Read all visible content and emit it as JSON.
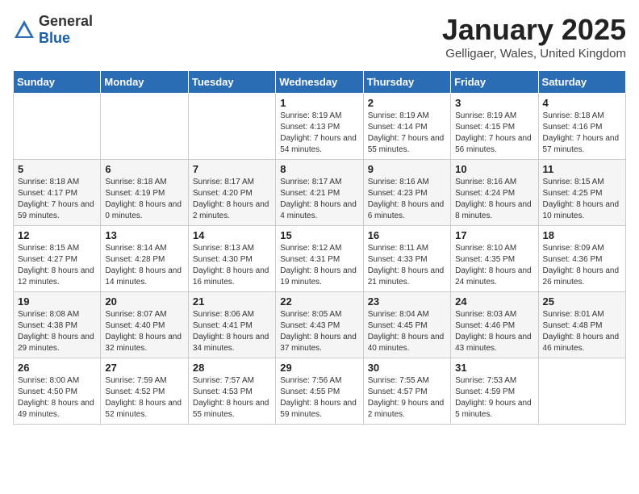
{
  "logo": {
    "text_general": "General",
    "text_blue": "Blue"
  },
  "header": {
    "month": "January 2025",
    "location": "Gelligaer, Wales, United Kingdom"
  },
  "weekdays": [
    "Sunday",
    "Monday",
    "Tuesday",
    "Wednesday",
    "Thursday",
    "Friday",
    "Saturday"
  ],
  "weeks": [
    [
      {
        "day": "",
        "sunrise": "",
        "sunset": "",
        "daylight": ""
      },
      {
        "day": "",
        "sunrise": "",
        "sunset": "",
        "daylight": ""
      },
      {
        "day": "",
        "sunrise": "",
        "sunset": "",
        "daylight": ""
      },
      {
        "day": "1",
        "sunrise": "Sunrise: 8:19 AM",
        "sunset": "Sunset: 4:13 PM",
        "daylight": "Daylight: 7 hours and 54 minutes."
      },
      {
        "day": "2",
        "sunrise": "Sunrise: 8:19 AM",
        "sunset": "Sunset: 4:14 PM",
        "daylight": "Daylight: 7 hours and 55 minutes."
      },
      {
        "day": "3",
        "sunrise": "Sunrise: 8:19 AM",
        "sunset": "Sunset: 4:15 PM",
        "daylight": "Daylight: 7 hours and 56 minutes."
      },
      {
        "day": "4",
        "sunrise": "Sunrise: 8:18 AM",
        "sunset": "Sunset: 4:16 PM",
        "daylight": "Daylight: 7 hours and 57 minutes."
      }
    ],
    [
      {
        "day": "5",
        "sunrise": "Sunrise: 8:18 AM",
        "sunset": "Sunset: 4:17 PM",
        "daylight": "Daylight: 7 hours and 59 minutes."
      },
      {
        "day": "6",
        "sunrise": "Sunrise: 8:18 AM",
        "sunset": "Sunset: 4:19 PM",
        "daylight": "Daylight: 8 hours and 0 minutes."
      },
      {
        "day": "7",
        "sunrise": "Sunrise: 8:17 AM",
        "sunset": "Sunset: 4:20 PM",
        "daylight": "Daylight: 8 hours and 2 minutes."
      },
      {
        "day": "8",
        "sunrise": "Sunrise: 8:17 AM",
        "sunset": "Sunset: 4:21 PM",
        "daylight": "Daylight: 8 hours and 4 minutes."
      },
      {
        "day": "9",
        "sunrise": "Sunrise: 8:16 AM",
        "sunset": "Sunset: 4:23 PM",
        "daylight": "Daylight: 8 hours and 6 minutes."
      },
      {
        "day": "10",
        "sunrise": "Sunrise: 8:16 AM",
        "sunset": "Sunset: 4:24 PM",
        "daylight": "Daylight: 8 hours and 8 minutes."
      },
      {
        "day": "11",
        "sunrise": "Sunrise: 8:15 AM",
        "sunset": "Sunset: 4:25 PM",
        "daylight": "Daylight: 8 hours and 10 minutes."
      }
    ],
    [
      {
        "day": "12",
        "sunrise": "Sunrise: 8:15 AM",
        "sunset": "Sunset: 4:27 PM",
        "daylight": "Daylight: 8 hours and 12 minutes."
      },
      {
        "day": "13",
        "sunrise": "Sunrise: 8:14 AM",
        "sunset": "Sunset: 4:28 PM",
        "daylight": "Daylight: 8 hours and 14 minutes."
      },
      {
        "day": "14",
        "sunrise": "Sunrise: 8:13 AM",
        "sunset": "Sunset: 4:30 PM",
        "daylight": "Daylight: 8 hours and 16 minutes."
      },
      {
        "day": "15",
        "sunrise": "Sunrise: 8:12 AM",
        "sunset": "Sunset: 4:31 PM",
        "daylight": "Daylight: 8 hours and 19 minutes."
      },
      {
        "day": "16",
        "sunrise": "Sunrise: 8:11 AM",
        "sunset": "Sunset: 4:33 PM",
        "daylight": "Daylight: 8 hours and 21 minutes."
      },
      {
        "day": "17",
        "sunrise": "Sunrise: 8:10 AM",
        "sunset": "Sunset: 4:35 PM",
        "daylight": "Daylight: 8 hours and 24 minutes."
      },
      {
        "day": "18",
        "sunrise": "Sunrise: 8:09 AM",
        "sunset": "Sunset: 4:36 PM",
        "daylight": "Daylight: 8 hours and 26 minutes."
      }
    ],
    [
      {
        "day": "19",
        "sunrise": "Sunrise: 8:08 AM",
        "sunset": "Sunset: 4:38 PM",
        "daylight": "Daylight: 8 hours and 29 minutes."
      },
      {
        "day": "20",
        "sunrise": "Sunrise: 8:07 AM",
        "sunset": "Sunset: 4:40 PM",
        "daylight": "Daylight: 8 hours and 32 minutes."
      },
      {
        "day": "21",
        "sunrise": "Sunrise: 8:06 AM",
        "sunset": "Sunset: 4:41 PM",
        "daylight": "Daylight: 8 hours and 34 minutes."
      },
      {
        "day": "22",
        "sunrise": "Sunrise: 8:05 AM",
        "sunset": "Sunset: 4:43 PM",
        "daylight": "Daylight: 8 hours and 37 minutes."
      },
      {
        "day": "23",
        "sunrise": "Sunrise: 8:04 AM",
        "sunset": "Sunset: 4:45 PM",
        "daylight": "Daylight: 8 hours and 40 minutes."
      },
      {
        "day": "24",
        "sunrise": "Sunrise: 8:03 AM",
        "sunset": "Sunset: 4:46 PM",
        "daylight": "Daylight: 8 hours and 43 minutes."
      },
      {
        "day": "25",
        "sunrise": "Sunrise: 8:01 AM",
        "sunset": "Sunset: 4:48 PM",
        "daylight": "Daylight: 8 hours and 46 minutes."
      }
    ],
    [
      {
        "day": "26",
        "sunrise": "Sunrise: 8:00 AM",
        "sunset": "Sunset: 4:50 PM",
        "daylight": "Daylight: 8 hours and 49 minutes."
      },
      {
        "day": "27",
        "sunrise": "Sunrise: 7:59 AM",
        "sunset": "Sunset: 4:52 PM",
        "daylight": "Daylight: 8 hours and 52 minutes."
      },
      {
        "day": "28",
        "sunrise": "Sunrise: 7:57 AM",
        "sunset": "Sunset: 4:53 PM",
        "daylight": "Daylight: 8 hours and 55 minutes."
      },
      {
        "day": "29",
        "sunrise": "Sunrise: 7:56 AM",
        "sunset": "Sunset: 4:55 PM",
        "daylight": "Daylight: 8 hours and 59 minutes."
      },
      {
        "day": "30",
        "sunrise": "Sunrise: 7:55 AM",
        "sunset": "Sunset: 4:57 PM",
        "daylight": "Daylight: 9 hours and 2 minutes."
      },
      {
        "day": "31",
        "sunrise": "Sunrise: 7:53 AM",
        "sunset": "Sunset: 4:59 PM",
        "daylight": "Daylight: 9 hours and 5 minutes."
      },
      {
        "day": "",
        "sunrise": "",
        "sunset": "",
        "daylight": ""
      }
    ]
  ]
}
